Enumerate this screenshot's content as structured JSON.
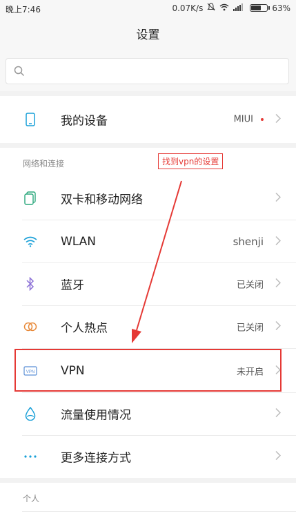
{
  "status_bar": {
    "time": "晚上7:46",
    "speed": "0.07K/s",
    "battery": "63%",
    "battery_level": 0.63
  },
  "header": {
    "title": "设置"
  },
  "search": {
    "placeholder": ""
  },
  "device_row": {
    "label": "我的设备",
    "value": "MIUI"
  },
  "network_section": {
    "title": "网络和连接",
    "items": [
      {
        "label": "双卡和移动网络",
        "value": "",
        "icon": "sim-card-icon"
      },
      {
        "label": "WLAN",
        "value": "shenji",
        "icon": "wifi-icon"
      },
      {
        "label": "蓝牙",
        "value": "已关闭",
        "icon": "bluetooth-icon"
      },
      {
        "label": "个人热点",
        "value": "已关闭",
        "icon": "hotspot-icon"
      },
      {
        "label": "VPN",
        "value": "未开启",
        "icon": "vpn-icon"
      },
      {
        "label": "流量使用情况",
        "value": "",
        "icon": "data-usage-icon"
      },
      {
        "label": "更多连接方式",
        "value": "",
        "icon": "more-icon"
      }
    ]
  },
  "personal_section": {
    "title": "个人"
  },
  "annotation": {
    "text": "找到vpn的设置"
  },
  "colors": {
    "accent": "#1aa0d8",
    "annotation_red": "#e53935"
  }
}
